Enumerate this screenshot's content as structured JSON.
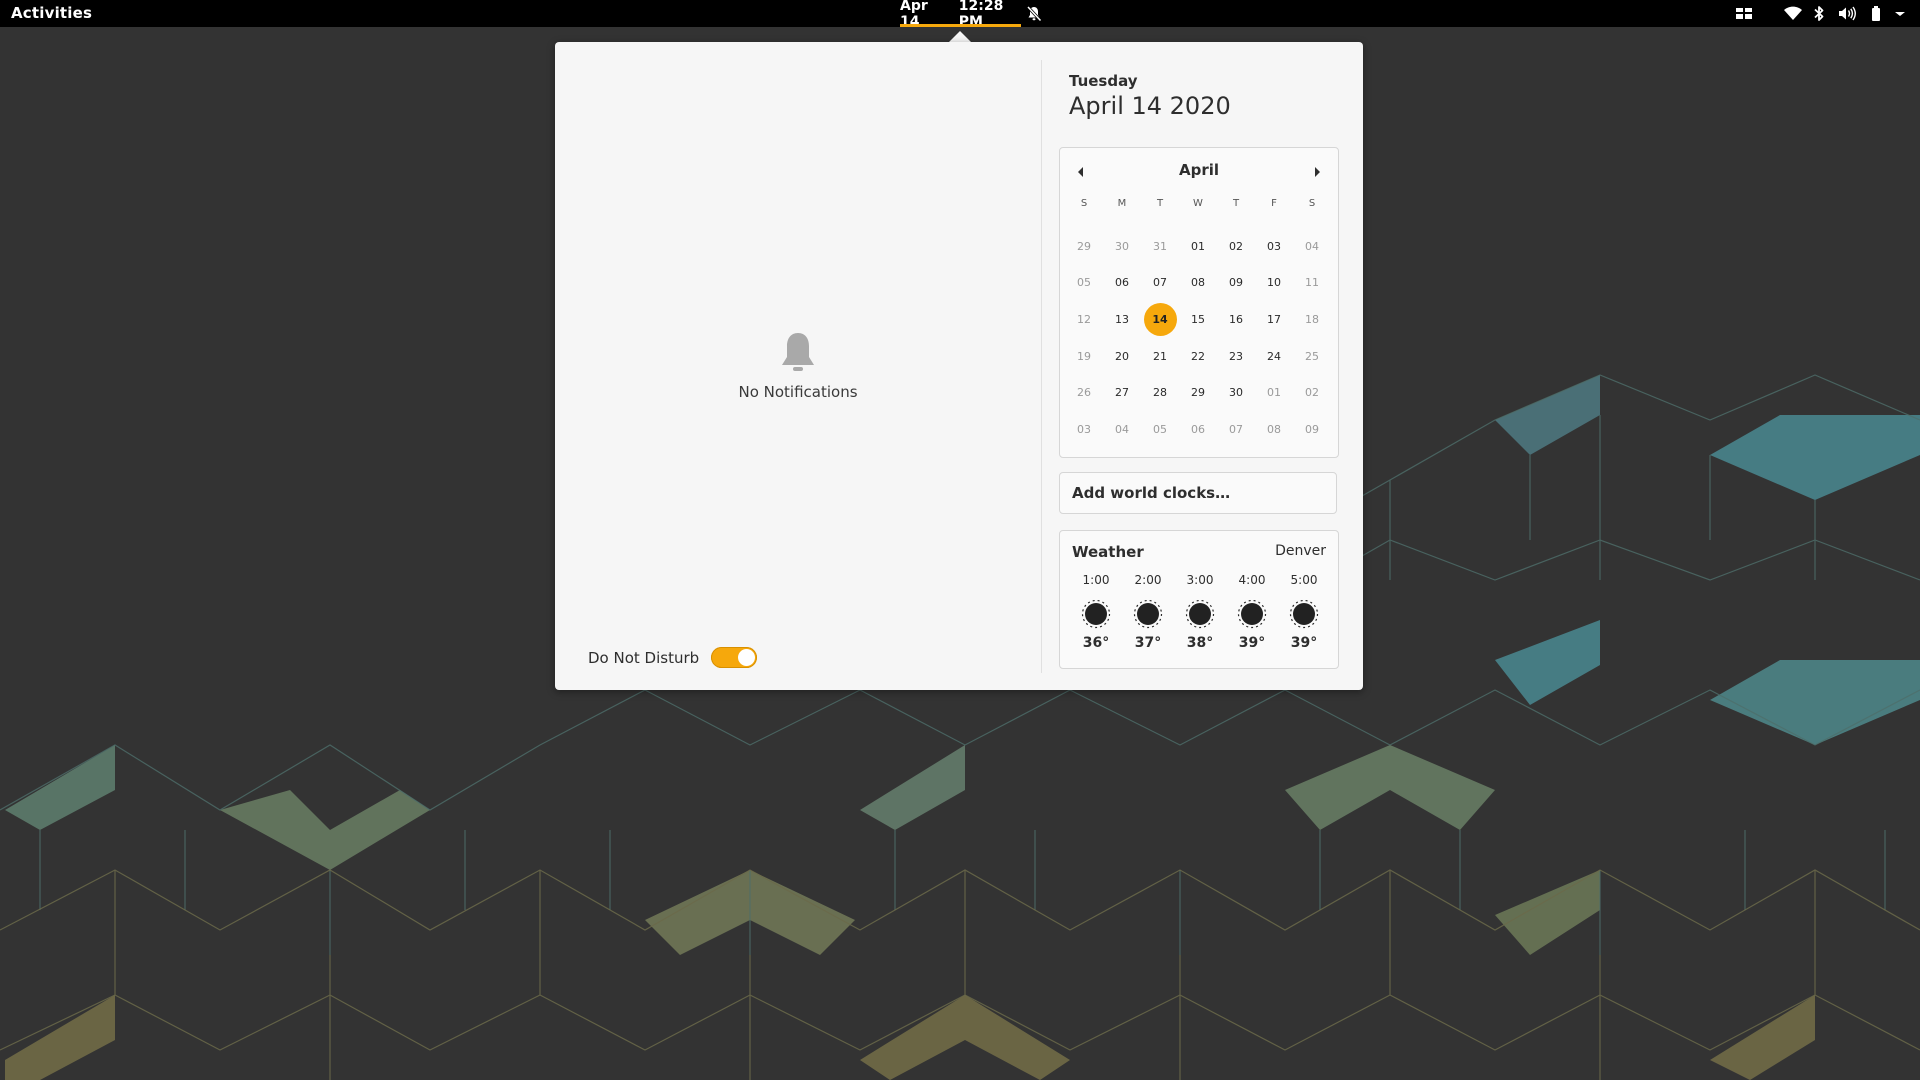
{
  "topbar": {
    "activities": "Activities",
    "date": "Apr 14",
    "time": "12:28 PM",
    "accent_color": "#f6a80c",
    "tray_icons": [
      "workspaces-icon",
      "wifi-icon",
      "bluetooth-icon",
      "volume-icon",
      "battery-icon",
      "system-menu-chevron-icon"
    ]
  },
  "notifications": {
    "empty_label": "No Notifications",
    "dnd_label": "Do Not Disturb",
    "dnd_enabled": true
  },
  "date_header": {
    "weekday": "Tuesday",
    "full_date": "April 14 2020"
  },
  "calendar": {
    "month": "April",
    "weekdays": [
      "S",
      "M",
      "T",
      "W",
      "T",
      "F",
      "S"
    ],
    "days": [
      {
        "label": "29",
        "other": true
      },
      {
        "label": "30",
        "other": true
      },
      {
        "label": "31",
        "other": true
      },
      {
        "label": "01",
        "other": false
      },
      {
        "label": "02",
        "other": false
      },
      {
        "label": "03",
        "other": false
      },
      {
        "label": "04",
        "other": true
      },
      {
        "label": "05",
        "other": true
      },
      {
        "label": "06",
        "other": false
      },
      {
        "label": "07",
        "other": false
      },
      {
        "label": "08",
        "other": false
      },
      {
        "label": "09",
        "other": false
      },
      {
        "label": "10",
        "other": false
      },
      {
        "label": "11",
        "other": true
      },
      {
        "label": "12",
        "other": true
      },
      {
        "label": "13",
        "other": false
      },
      {
        "label": "14",
        "other": false,
        "today": true
      },
      {
        "label": "15",
        "other": false
      },
      {
        "label": "16",
        "other": false
      },
      {
        "label": "17",
        "other": false
      },
      {
        "label": "18",
        "other": true
      },
      {
        "label": "19",
        "other": true
      },
      {
        "label": "20",
        "other": false
      },
      {
        "label": "21",
        "other": false
      },
      {
        "label": "22",
        "other": false
      },
      {
        "label": "23",
        "other": false
      },
      {
        "label": "24",
        "other": false
      },
      {
        "label": "25",
        "other": true
      },
      {
        "label": "26",
        "other": true
      },
      {
        "label": "27",
        "other": false
      },
      {
        "label": "28",
        "other": false
      },
      {
        "label": "29",
        "other": false
      },
      {
        "label": "30",
        "other": false
      },
      {
        "label": "01",
        "other": true
      },
      {
        "label": "02",
        "other": true
      },
      {
        "label": "03",
        "other": true
      },
      {
        "label": "04",
        "other": true
      },
      {
        "label": "05",
        "other": true
      },
      {
        "label": "06",
        "other": true
      },
      {
        "label": "07",
        "other": true
      },
      {
        "label": "08",
        "other": true
      },
      {
        "label": "09",
        "other": true
      }
    ]
  },
  "world_clocks": {
    "label": "Add world clocks…"
  },
  "weather": {
    "title": "Weather",
    "location": "Denver",
    "forecast": [
      {
        "time": "1:00",
        "temp": "36°",
        "icon": "clear-night-icon"
      },
      {
        "time": "2:00",
        "temp": "37°",
        "icon": "clear-night-icon"
      },
      {
        "time": "3:00",
        "temp": "38°",
        "icon": "clear-night-icon"
      },
      {
        "time": "4:00",
        "temp": "39°",
        "icon": "clear-night-icon"
      },
      {
        "time": "5:00",
        "temp": "39°",
        "icon": "clear-night-icon"
      }
    ]
  }
}
